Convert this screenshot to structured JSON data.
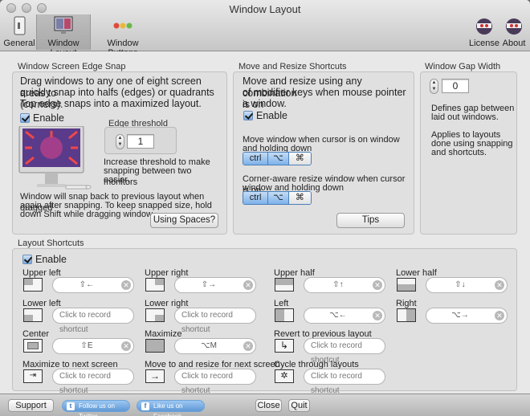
{
  "window": {
    "title": "Window Layout"
  },
  "toolbar": {
    "general": "General",
    "window_layout": "Window Layout",
    "window_buttons": "Window Buttons",
    "license": "License",
    "about": "About"
  },
  "edge_snap": {
    "title": "Window Screen Edge Snap",
    "desc_1": "Drag windows to any one of eight screen areas to",
    "desc_2": "quickly snap into halfs (edges) or quadrants (corners).",
    "desc_3": "Top edge snaps into a maximized layout.",
    "enable": "Enable",
    "threshold_label": "Edge threshold",
    "threshold_value": "1",
    "threshold_help_1": "Increase threshold to make",
    "threshold_help_2": "snapping between two monitors",
    "threshold_help_3": "easier.",
    "note_1": "Window will snap back to previous layout when dragged",
    "note_2": "again after snapping. To keep snapped size, hold",
    "note_3": "down Shift while dragging window.",
    "spaces_button": "Using Spaces?"
  },
  "move_resize": {
    "title": "Move and Resize Shortcuts",
    "desc_1": "Move and resize using any combination",
    "desc_2": "of modifier keys when mouse pointer is on",
    "desc_3": "a window.",
    "enable": "Enable",
    "move_label_1": "Move window when cursor is on window",
    "move_label_2": "and holding down",
    "move_keys": [
      "ctrl",
      "⌥",
      "⌘"
    ],
    "resize_label_1": "Corner-aware resize window when cursor is on",
    "resize_label_2": "window and holding down",
    "resize_keys": [
      "ctrl",
      "⌥",
      "⌘"
    ],
    "tips_button": "Tips"
  },
  "gap": {
    "title": "Window Gap Width",
    "value": "0",
    "desc_1": "Defines gap between",
    "desc_2": "laid out windows.",
    "desc_3": "Applies to layouts",
    "desc_4": "done using snapping",
    "desc_5": "and shortcuts."
  },
  "layout_shortcuts": {
    "title": "Layout Shortcuts",
    "enable": "Enable",
    "items": [
      {
        "label": "Upper left",
        "value": "⇧←",
        "icon": "upper-left-icon"
      },
      {
        "label": "Upper right",
        "value": "⇧→",
        "icon": "upper-right-icon"
      },
      {
        "label": "Upper half",
        "value": "⇧↑",
        "icon": "upper-half-icon"
      },
      {
        "label": "Lower half",
        "value": "⇧↓",
        "icon": "lower-half-icon"
      },
      {
        "label": "Lower left",
        "value": "Click to record shortcut",
        "icon": "lower-left-icon"
      },
      {
        "label": "Lower right",
        "value": "Click to record shortcut",
        "icon": "lower-right-icon"
      },
      {
        "label": "Left",
        "value": "⌥←",
        "icon": "left-half-icon"
      },
      {
        "label": "Right",
        "value": "⌥→",
        "icon": "right-half-icon"
      },
      {
        "label": "Center",
        "value": "⇧E",
        "icon": "center-icon"
      },
      {
        "label": "Maximize",
        "value": "⌥M",
        "icon": "maximize-icon"
      },
      {
        "label": "Revert to previous layout",
        "value": "Click to record shortcut",
        "icon": "revert-icon"
      },
      {
        "label": "Maximize to next screen",
        "value": "Click to record shortcut",
        "icon": "next-screen-icon"
      },
      {
        "label": "Move to and resize for next screen",
        "value": "Click to record shortcut",
        "icon": "move-next-screen-icon"
      },
      {
        "label": "Cycle through layouts",
        "value": "Click to record shortcut",
        "icon": "cycle-icon"
      }
    ]
  },
  "bottom": {
    "support": "Support",
    "twitter": "Follow us on Twitter",
    "facebook": "Like us on Facebook",
    "close": "Close",
    "quit": "Quit"
  }
}
